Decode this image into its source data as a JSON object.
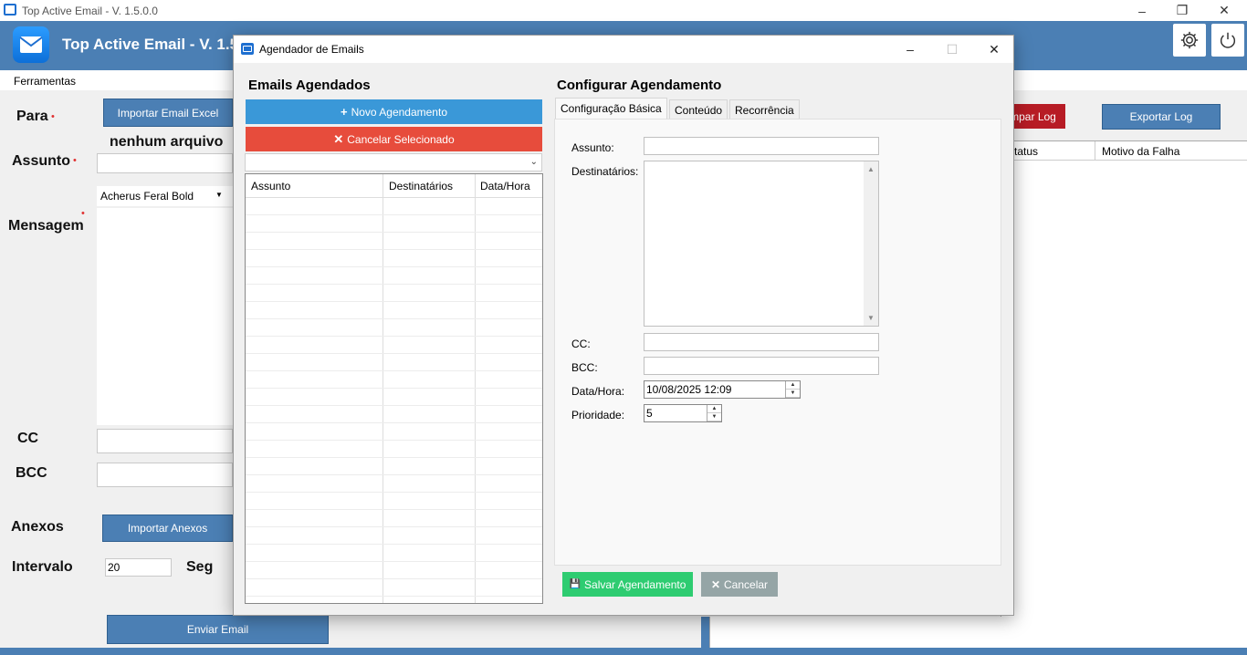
{
  "window": {
    "title": "Top Active Email - V. 1.5.0.0"
  },
  "header": {
    "app_title": "Top Active Email - V. 1.5"
  },
  "menu": {
    "tools": "Ferramentas"
  },
  "form": {
    "to_label": "Para",
    "import_excel": "Importar Email Excel",
    "no_file": "nenhum arquivo",
    "subject_label": "Assunto",
    "font_name": "Acherus Feral Bold",
    "message_label": "Mensagem",
    "cc_label": "CC",
    "bcc_label": "BCC",
    "attachments_label": "Anexos",
    "import_attachments": "Importar Anexos",
    "interval_label": "Intervalo",
    "interval_value": "20",
    "seconds": "Seg",
    "send": "Enviar Email"
  },
  "log": {
    "clear": "mpar Log",
    "export": "Exportar Log",
    "col_status": "tatus",
    "col_reason": "Motivo da Falha"
  },
  "dialog": {
    "title": "Agendador de Emails",
    "left_title": "Emails Agendados",
    "new_button": "Novo Agendamento",
    "cancel_selected": "Cancelar Selecionado",
    "columns": [
      "Assunto",
      "Destinatários",
      "Data/Hora"
    ],
    "right_title": "Configurar Agendamento",
    "tabs": [
      "Configuração Básica",
      "Conteúdo",
      "Recorrência"
    ],
    "fields": {
      "subject": "Assunto:",
      "recipients": "Destinatários:",
      "cc": "CC:",
      "bcc": "BCC:",
      "datetime": "Data/Hora:",
      "datetime_value": "10/08/2025 12:09",
      "priority": "Prioridade:",
      "priority_value": "5"
    },
    "save": "Salvar Agendamento",
    "cancel": "Cancelar"
  },
  "colors": {
    "header_blue": "#4b7fb4",
    "new_blue": "#3a98d8",
    "cancel_red": "#e74c3c",
    "save_green": "#2ecc71",
    "cancel_gray": "#95a5a6",
    "log_red": "#b71c25"
  }
}
